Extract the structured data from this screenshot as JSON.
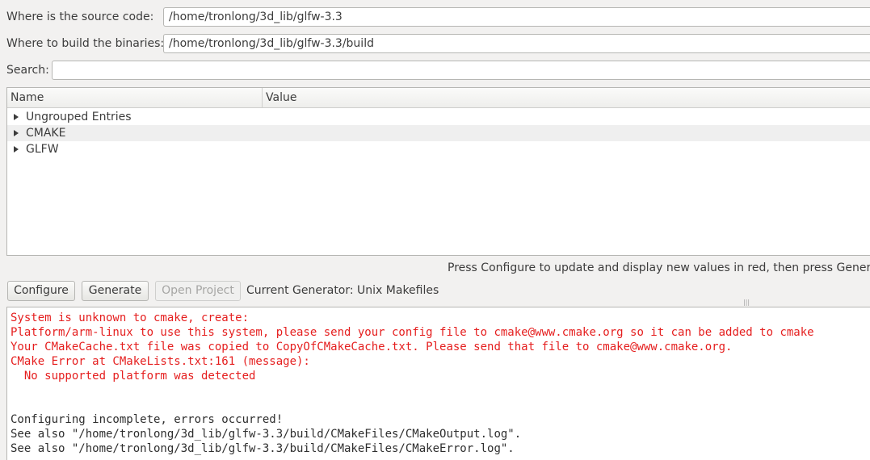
{
  "source": {
    "label": "Where is the source code:",
    "value": "/home/tronlong/3d_lib/glfw-3.3"
  },
  "build": {
    "label": "Where to build the binaries:",
    "value": "/home/tronlong/3d_lib/glfw-3.3/build"
  },
  "search": {
    "label": "Search:",
    "value": ""
  },
  "tree": {
    "columns": [
      "Name",
      "Value"
    ],
    "items": [
      {
        "label": "Ungrouped Entries"
      },
      {
        "label": "CMAKE"
      },
      {
        "label": "GLFW"
      }
    ]
  },
  "hint": "Press Configure to update and display new values in red, then press Generate",
  "buttons": {
    "configure": "Configure",
    "generate": "Generate",
    "open_project": "Open Project"
  },
  "generator": "Current Generator: Unix Makefiles",
  "output": {
    "lines": [
      {
        "text": "System is unknown to cmake, create:",
        "error": true
      },
      {
        "text": "Platform/arm-linux to use this system, please send your config file to cmake@www.cmake.org so it can be added to cmake",
        "error": true
      },
      {
        "text": "Your CMakeCache.txt file was copied to CopyOfCMakeCache.txt. Please send that file to cmake@www.cmake.org.",
        "error": true
      },
      {
        "text": "CMake Error at CMakeLists.txt:161 (message):",
        "error": true
      },
      {
        "text": "  No supported platform was detected",
        "error": true
      },
      {
        "text": "",
        "error": false
      },
      {
        "text": "",
        "error": false
      },
      {
        "text": "Configuring incomplete, errors occurred!",
        "error": false
      },
      {
        "text": "See also \"/home/tronlong/3d_lib/glfw-3.3/build/CMakeFiles/CMakeOutput.log\".",
        "error": false
      },
      {
        "text": "See also \"/home/tronlong/3d_lib/glfw-3.3/build/CMakeFiles/CMakeError.log\".",
        "error": false
      }
    ]
  },
  "colors": {
    "error_text": "#e51e1e",
    "window_bg": "#f2f1f0"
  }
}
